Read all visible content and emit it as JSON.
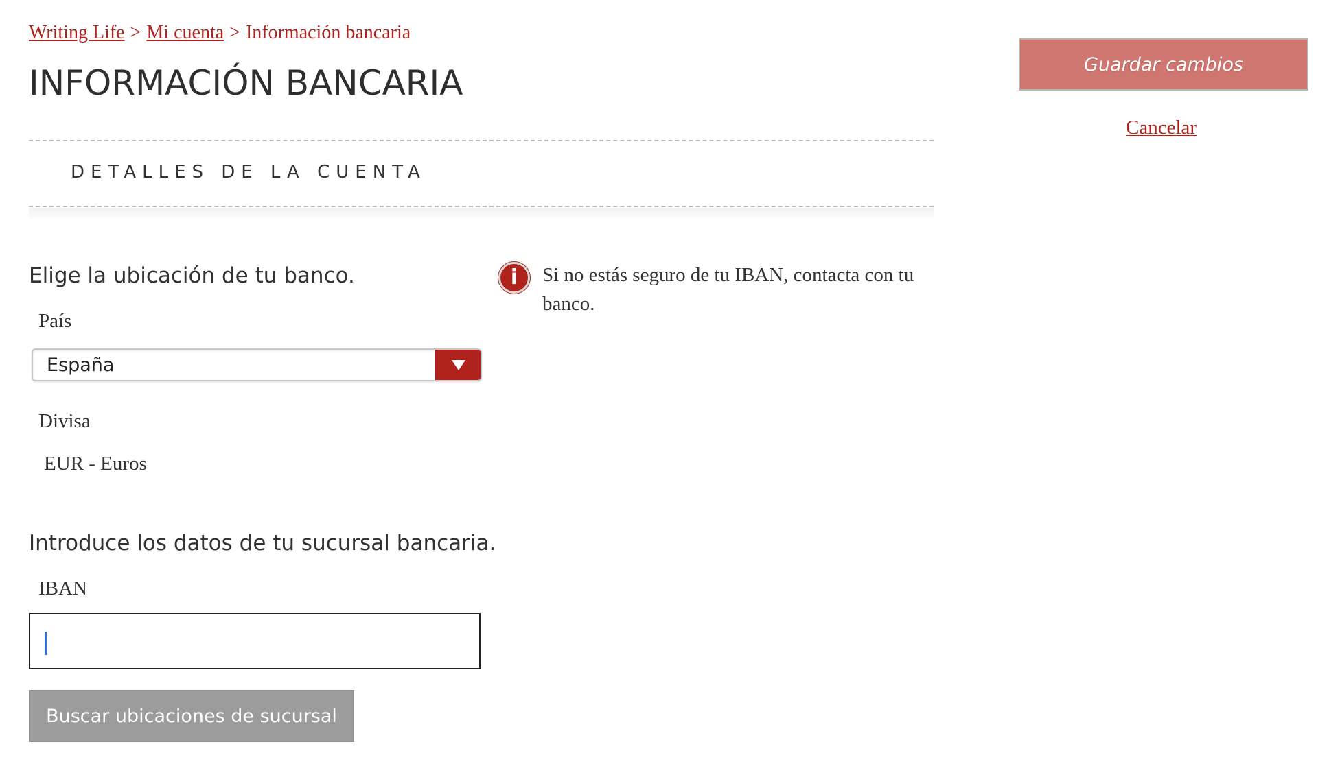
{
  "breadcrumb": {
    "items": [
      "Writing Life",
      "Mi cuenta",
      "Información bancaria"
    ],
    "separator": ">"
  },
  "page": {
    "title": "INFORMACIÓN BANCARIA"
  },
  "section": {
    "title": "DETALLES DE LA CUENTA"
  },
  "location": {
    "prompt": "Elige la ubicación de tu banco.",
    "country_label": "País",
    "country_value": "España",
    "currency_label": "Divisa",
    "currency_value": "EUR - Euros"
  },
  "branch": {
    "prompt": "Introduce los datos de tu sucursal bancaria.",
    "iban_label": "IBAN",
    "iban_value": "",
    "search_button": "Buscar ubicaciones de sucursal"
  },
  "info": {
    "icon": "info-icon",
    "glyph": "i",
    "text": "Si no estás seguro de tu IBAN, contacta con tu banco."
  },
  "actions": {
    "save_label": "Guardar cambios",
    "cancel_label": "Cancelar"
  },
  "colors": {
    "accent": "#b0231c",
    "save_button": "#d07670",
    "search_button": "#9c9c9c"
  }
}
